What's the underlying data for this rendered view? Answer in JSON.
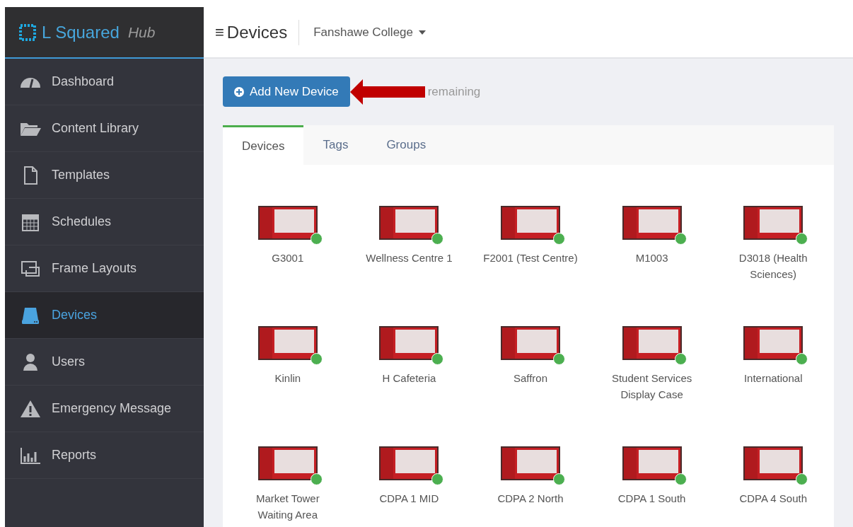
{
  "brand": {
    "name": "L Squared",
    "suffix": "Hub"
  },
  "header": {
    "menu_glyph": "≡",
    "title": "Devices",
    "organization": "Fanshawe College"
  },
  "sidebar": {
    "items": [
      {
        "label": "Dashboard",
        "kind": "dashboard",
        "selected": false
      },
      {
        "label": "Content Library",
        "kind": "folder",
        "selected": false
      },
      {
        "label": "Templates",
        "kind": "file",
        "selected": false
      },
      {
        "label": "Schedules",
        "kind": "calendar",
        "selected": false
      },
      {
        "label": "Frame Layouts",
        "kind": "frame",
        "selected": false
      },
      {
        "label": "Devices",
        "kind": "drive",
        "selected": true
      },
      {
        "label": "Users",
        "kind": "user",
        "selected": false
      },
      {
        "label": "Emergency Message",
        "kind": "warning",
        "selected": false
      },
      {
        "label": "Reports",
        "kind": "chart",
        "selected": false
      }
    ]
  },
  "toolbar": {
    "add_button": "Add New Device",
    "licenses_note": "remaining"
  },
  "tabs": [
    {
      "label": "Devices",
      "selected": true
    },
    {
      "label": "Tags",
      "selected": false
    },
    {
      "label": "Groups",
      "selected": false
    }
  ],
  "devices": [
    {
      "name": "G3001",
      "color": "#4caf50"
    },
    {
      "name": "Wellness Centre 1",
      "color": "#4caf50"
    },
    {
      "name": "F2001 (Test Centre)",
      "color": "#4caf50"
    },
    {
      "name": "M1003",
      "color": "#4caf50"
    },
    {
      "name": "D3018 (Health Sciences)",
      "color": "#4caf50"
    },
    {
      "name": "Kinlin",
      "color": "#4caf50"
    },
    {
      "name": "H Cafeteria",
      "color": "#4caf50"
    },
    {
      "name": "Saffron",
      "color": "#4caf50"
    },
    {
      "name": "Student Services Display Case",
      "color": "#4caf50"
    },
    {
      "name": "International",
      "color": "#4caf50"
    },
    {
      "name": "Market Tower Waiting Area",
      "color": "#4caf50"
    },
    {
      "name": "CDPA 1 MID",
      "color": "#4caf50"
    },
    {
      "name": "CDPA 2 North",
      "color": "#4caf50"
    },
    {
      "name": "CDPA 1 South",
      "color": "#4caf50"
    },
    {
      "name": "CDPA 4 South",
      "color": "#4caf50"
    }
  ]
}
